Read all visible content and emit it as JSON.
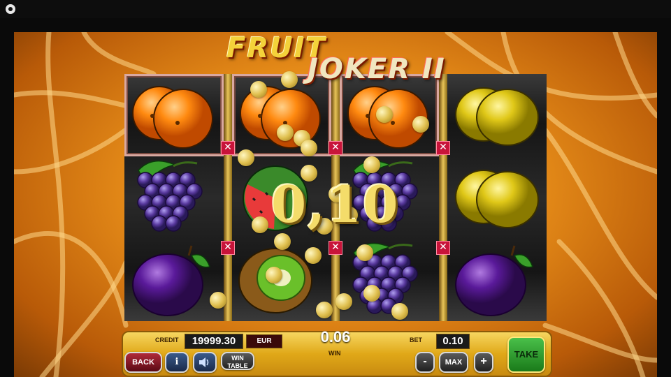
{
  "game": {
    "title_line1": "FRUIT",
    "title_line2": "JOKER II",
    "win_amount_display": "0,10"
  },
  "reels": [
    [
      "orange",
      "grapes",
      "plum"
    ],
    [
      "orange",
      "watermelon",
      "kiwi"
    ],
    [
      "orange",
      "grapes",
      "grapes"
    ],
    [
      "lemon",
      "lemon",
      "plum"
    ]
  ],
  "winning_cells": [
    [
      0,
      0
    ],
    [
      1,
      0
    ],
    [
      2,
      0
    ]
  ],
  "panel": {
    "credit_label": "CREDIT",
    "credit_value": "19999.30",
    "currency": "EUR",
    "win_value": "0.06",
    "win_label": "WIN",
    "bet_label": "BET",
    "bet_value": "0.10"
  },
  "buttons": {
    "back": "BACK",
    "info": "i",
    "sound_icon": "speaker-icon",
    "win_table_line1": "WIN",
    "win_table_line2": "TABLE",
    "bet_minus": "-",
    "max": "MAX",
    "bet_plus": "+",
    "take": "TAKE"
  },
  "colors": {
    "background": "#e48a18",
    "panel": "#e0a818",
    "take_button": "#4ac04a",
    "win_marker": "#c8143a"
  }
}
